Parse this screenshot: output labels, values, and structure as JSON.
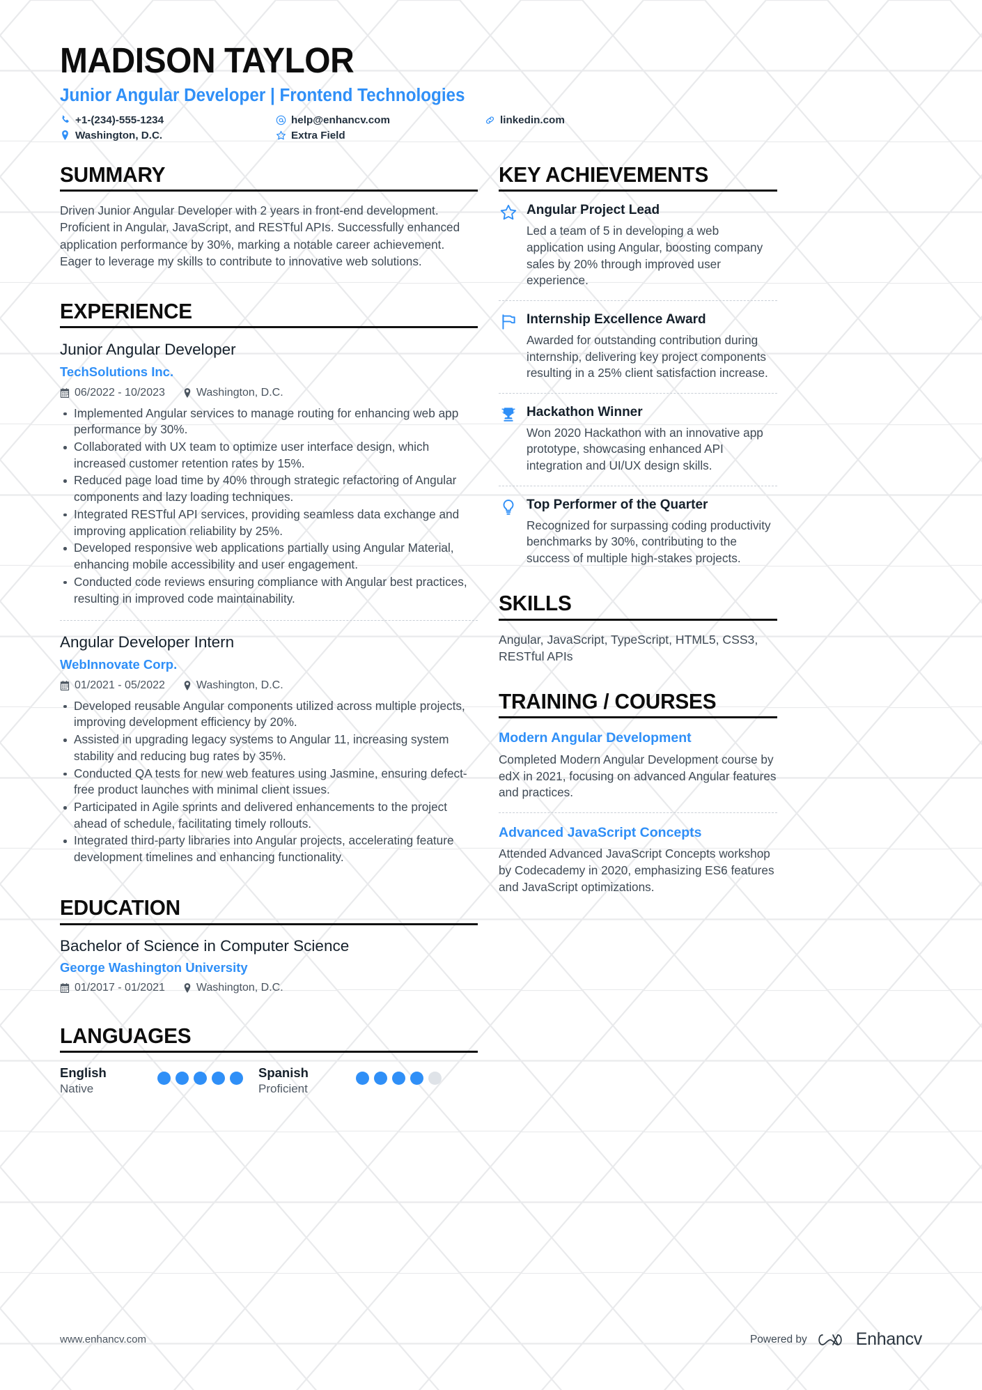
{
  "header": {
    "name": "MADISON TAYLOR",
    "headline": "Junior Angular Developer | Frontend Technologies",
    "contacts": [
      {
        "icon": "phone-icon",
        "text": "+1-(234)-555-1234"
      },
      {
        "icon": "email-icon",
        "text": "help@enhancv.com"
      },
      {
        "icon": "link-icon",
        "text": "linkedin.com"
      },
      {
        "icon": "location-icon",
        "text": "Washington, D.C."
      },
      {
        "icon": "star-outline-icon",
        "text": "Extra Field"
      }
    ]
  },
  "sections": {
    "summary": {
      "title": "SUMMARY",
      "text": "Driven Junior Angular Developer with 2 years in front-end development. Proficient in Angular, JavaScript, and RESTful APIs. Successfully enhanced application performance by 30%, marking a notable career achievement. Eager to leverage my skills to contribute to innovative web solutions."
    },
    "experience": {
      "title": "EXPERIENCE",
      "entries": [
        {
          "job_title": "Junior Angular Developer",
          "company": "TechSolutions Inc.",
          "dates": "06/2022 - 10/2023",
          "location": "Washington, D.C.",
          "bullets": [
            "Implemented Angular services to manage routing for enhancing web app performance by 30%.",
            "Collaborated with UX team to optimize user interface design, which increased customer retention rates by 15%.",
            "Reduced page load time by 40% through strategic refactoring of Angular components and lazy loading techniques.",
            "Integrated RESTful API services, providing seamless data exchange and improving application reliability by 25%.",
            "Developed responsive web applications partially using Angular Material, enhancing mobile accessibility and user engagement.",
            "Conducted code reviews ensuring compliance with Angular best practices, resulting in improved code maintainability."
          ]
        },
        {
          "job_title": "Angular Developer Intern",
          "company": "WebInnovate Corp.",
          "dates": "01/2021 - 05/2022",
          "location": "Washington, D.C.",
          "bullets": [
            "Developed reusable Angular components utilized across multiple projects, improving development efficiency by 20%.",
            "Assisted in upgrading legacy systems to Angular 11, increasing system stability and reducing bug rates by 35%.",
            "Conducted QA tests for new web features using Jasmine, ensuring defect-free product launches with minimal client issues.",
            "Participated in Agile sprints and delivered enhancements to the project ahead of schedule, facilitating timely rollouts.",
            "Integrated third-party libraries into Angular projects, accelerating feature development timelines and enhancing functionality."
          ]
        }
      ]
    },
    "education": {
      "title": "EDUCATION",
      "entries": [
        {
          "degree": "Bachelor of Science in Computer Science",
          "school": "George Washington University",
          "dates": "01/2017 - 01/2021",
          "location": "Washington, D.C."
        }
      ]
    },
    "languages": {
      "title": "LANGUAGES",
      "entries": [
        {
          "name": "English",
          "level": "Native",
          "filled": 5,
          "total": 5
        },
        {
          "name": "Spanish",
          "level": "Proficient",
          "filled": 4,
          "total": 5
        }
      ]
    },
    "achievements": {
      "title": "KEY ACHIEVEMENTS",
      "entries": [
        {
          "icon": "star-outline-icon",
          "title": "Angular Project Lead",
          "description": "Led a team of 5 in developing a web application using Angular, boosting company sales by 20% through improved user experience."
        },
        {
          "icon": "flag-icon",
          "title": "Internship Excellence Award",
          "description": "Awarded for outstanding contribution during internship, delivering key project components resulting in a 25% client satisfaction increase."
        },
        {
          "icon": "trophy-icon",
          "title": "Hackathon Winner",
          "description": "Won 2020 Hackathon with an innovative app prototype, showcasing enhanced API integration and UI/UX design skills."
        },
        {
          "icon": "lightbulb-icon",
          "title": "Top Performer of the Quarter",
          "description": "Recognized for surpassing coding productivity benchmarks by 30%, contributing to the success of multiple high-stakes projects."
        }
      ]
    },
    "skills": {
      "title": "SKILLS",
      "text": "Angular, JavaScript, TypeScript, HTML5, CSS3, RESTful APIs"
    },
    "training": {
      "title": "TRAINING / COURSES",
      "entries": [
        {
          "title": "Modern Angular Development",
          "description": "Completed Modern Angular Development course by edX in 2021, focusing on advanced Angular features and practices."
        },
        {
          "title": "Advanced JavaScript Concepts",
          "description": "Attended Advanced JavaScript Concepts workshop by Codecademy in 2020, emphasizing ES6 features and JavaScript optimizations."
        }
      ]
    }
  },
  "footer": {
    "url": "www.enhancv.com",
    "powered_by": "Powered by",
    "brand": "Enhancv"
  },
  "colors": {
    "accent": "#2f8ff7",
    "heading": "#0d0d0d",
    "body": "#3f4a55",
    "dot_off": "#dfe3e8"
  }
}
